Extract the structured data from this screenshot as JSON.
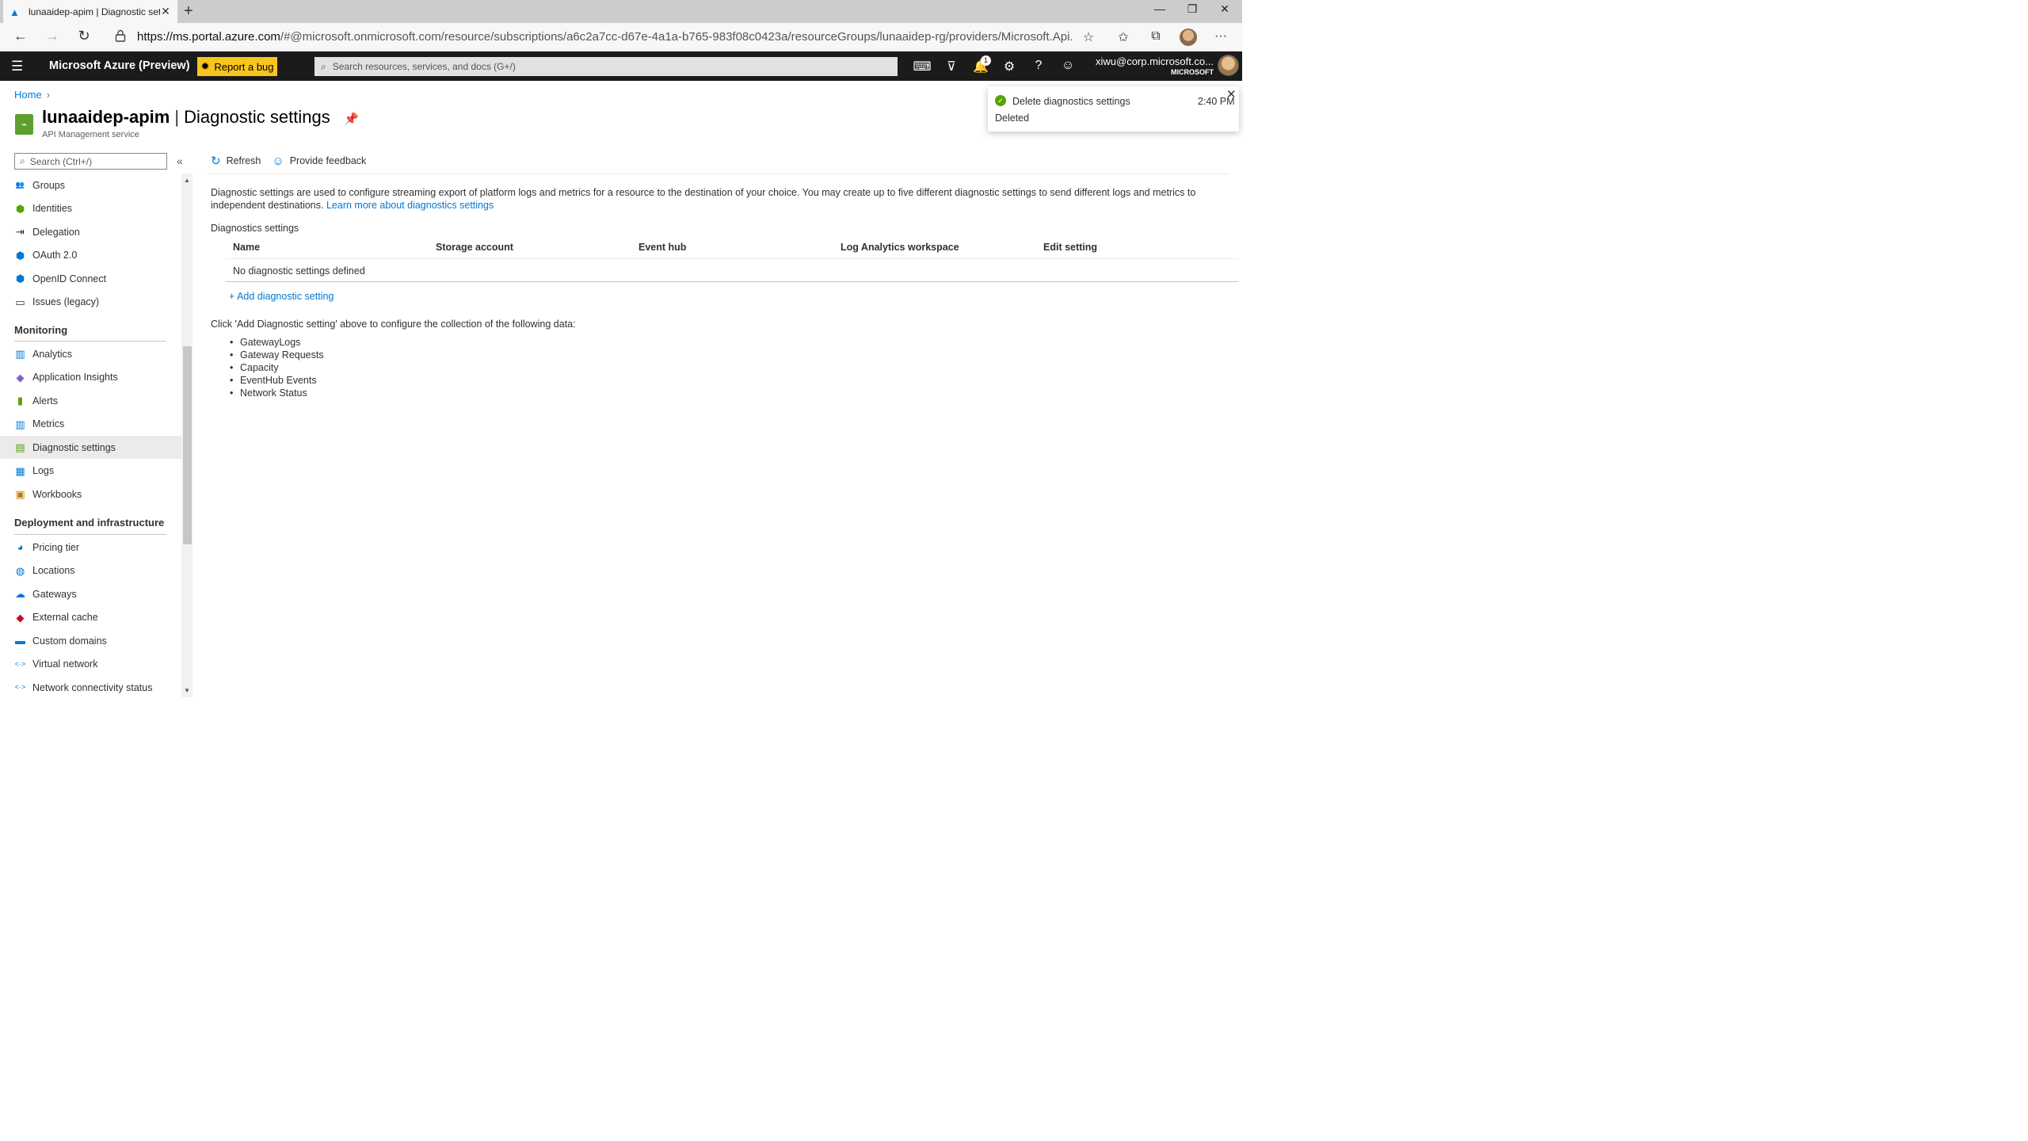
{
  "browser": {
    "tab_title": "lunaaidep-apim | Diagnostic setti",
    "tab_close": "✕",
    "new_tab": "+",
    "url_host": "https://ms.portal.azure.com",
    "url_path": "/#@microsoft.onmicrosoft.com/resource/subscriptions/a6c2a7cc-d67e-4a1a-b765-983f08c0423a/resourceGroups/lunaaidep-rg/providers/Microsoft.Api...",
    "window_controls": [
      "—",
      "❐",
      "✕"
    ]
  },
  "azure_bar": {
    "brand": "Microsoft Azure (Preview)",
    "bug_button": "Report a bug",
    "search_placeholder": "Search resources, services, and docs (G+/)",
    "notification_count": "1",
    "user_email": "xiwu@corp.microsoft.co...",
    "user_tenant": "MICROSOFT"
  },
  "breadcrumb": {
    "home": "Home",
    "sep": "›"
  },
  "header": {
    "resource_name": "lunaaidep-apim",
    "separator": "|",
    "page_name": "Diagnostic settings",
    "subtitle": "API Management service"
  },
  "sidebar": {
    "search_placeholder": "Search (Ctrl+/)",
    "collapse": "«",
    "items_top": [
      {
        "label": "Groups",
        "icon": "groups-icon",
        "glyph": "👥",
        "color": "#0078d4"
      },
      {
        "label": "Identities",
        "icon": "shield-icon",
        "glyph": "⬢",
        "color": "#57a300"
      },
      {
        "label": "Delegation",
        "icon": "delegation-icon",
        "glyph": "⇥",
        "color": "#323130"
      },
      {
        "label": "OAuth 2.0",
        "icon": "oauth-shield-icon",
        "glyph": "⬢",
        "color": "#0078d4"
      },
      {
        "label": "OpenID Connect",
        "icon": "openid-shield-icon",
        "glyph": "⬢",
        "color": "#0078d4"
      },
      {
        "label": "Issues (legacy)",
        "icon": "comment-icon",
        "glyph": "▭",
        "color": "#323130"
      }
    ],
    "section_monitoring": "Monitoring",
    "items_monitoring": [
      {
        "label": "Analytics",
        "icon": "analytics-chart-icon",
        "glyph": "▥",
        "color": "#0078d4"
      },
      {
        "label": "Application Insights",
        "icon": "app-insights-icon",
        "glyph": "◆",
        "color": "#8661c5"
      },
      {
        "label": "Alerts",
        "icon": "alerts-icon",
        "glyph": "▮",
        "color": "#57a300"
      },
      {
        "label": "Metrics",
        "icon": "metrics-chart-icon",
        "glyph": "▥",
        "color": "#0078d4"
      },
      {
        "label": "Diagnostic settings",
        "icon": "diagnostic-settings-icon",
        "glyph": "▤",
        "color": "#57a300"
      },
      {
        "label": "Logs",
        "icon": "logs-icon",
        "glyph": "▦",
        "color": "#0078d4"
      },
      {
        "label": "Workbooks",
        "icon": "workbooks-icon",
        "glyph": "▣",
        "color": "#c27c0e"
      }
    ],
    "section_deployment": "Deployment and infrastructure",
    "items_deployment": [
      {
        "label": "Pricing tier",
        "icon": "pricing-tier-icon",
        "glyph": "◕",
        "color": "#0078d4"
      },
      {
        "label": "Locations",
        "icon": "globe-icon",
        "glyph": "◍",
        "color": "#0078d4"
      },
      {
        "label": "Gateways",
        "icon": "cloud-icon",
        "glyph": "☁",
        "color": "#0078d4"
      },
      {
        "label": "External cache",
        "icon": "cache-icon",
        "glyph": "◆",
        "color": "#c50f1f"
      },
      {
        "label": "Custom domains",
        "icon": "custom-domains-icon",
        "glyph": "▬",
        "color": "#0078d4"
      },
      {
        "label": "Virtual network",
        "icon": "virtual-network-icon",
        "glyph": "<·>",
        "color": "#0078d4"
      },
      {
        "label": "Network connectivity status",
        "icon": "network-status-icon",
        "glyph": "<·>",
        "color": "#0078d4"
      }
    ],
    "active_label": "Diagnostic settings"
  },
  "commands": {
    "refresh": "Refresh",
    "feedback": "Provide feedback"
  },
  "main": {
    "description": "Diagnostic settings are used to configure streaming export of platform logs and metrics for a resource to the destination of your choice. You may create up to five different diagnostic settings to send different logs and metrics to independent destinations.",
    "learn_more": "Learn more about diagnostics settings",
    "section_label": "Diagnostics settings",
    "columns": [
      "Name",
      "Storage account",
      "Event hub",
      "Log Analytics workspace",
      "Edit setting"
    ],
    "empty_row": "No diagnostic settings defined",
    "add_link": "+ Add diagnostic setting",
    "click_text": "Click 'Add Diagnostic setting' above to configure the collection of the following data:",
    "data_items": [
      "GatewayLogs",
      "Gateway Requests",
      "Capacity",
      "EventHub Events",
      "Network Status"
    ]
  },
  "toast": {
    "title": "Delete diagnostics settings",
    "time": "2:40 PM",
    "body": "Deleted",
    "status_color": "#57a300"
  }
}
